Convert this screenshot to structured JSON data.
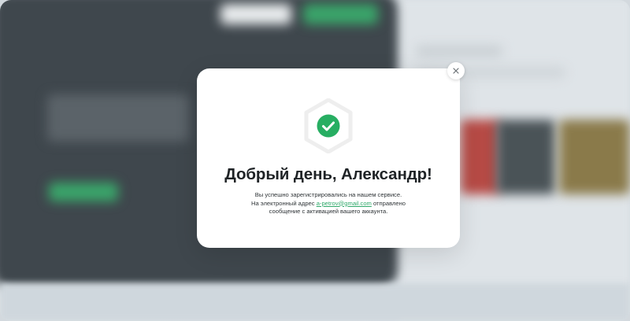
{
  "modal": {
    "title": "Добрый день, Александр!",
    "message_line1": "Вы успешно зарегистрировались на нашем сервисе.",
    "message_line2_prefix": "На электронный адрес",
    "email": "a-petrov@gmail.com",
    "message_line2_suffix": "отправлено",
    "message_line3": "сообщение с активацией вашего аккаунта.",
    "close_icon": "close-icon",
    "badge_icon": "check-circle-icon"
  },
  "colors": {
    "accent": "#2fa96a",
    "badge_hex": "#eeeeee",
    "title": "#1f2326",
    "background_dark": "#3f474d"
  }
}
